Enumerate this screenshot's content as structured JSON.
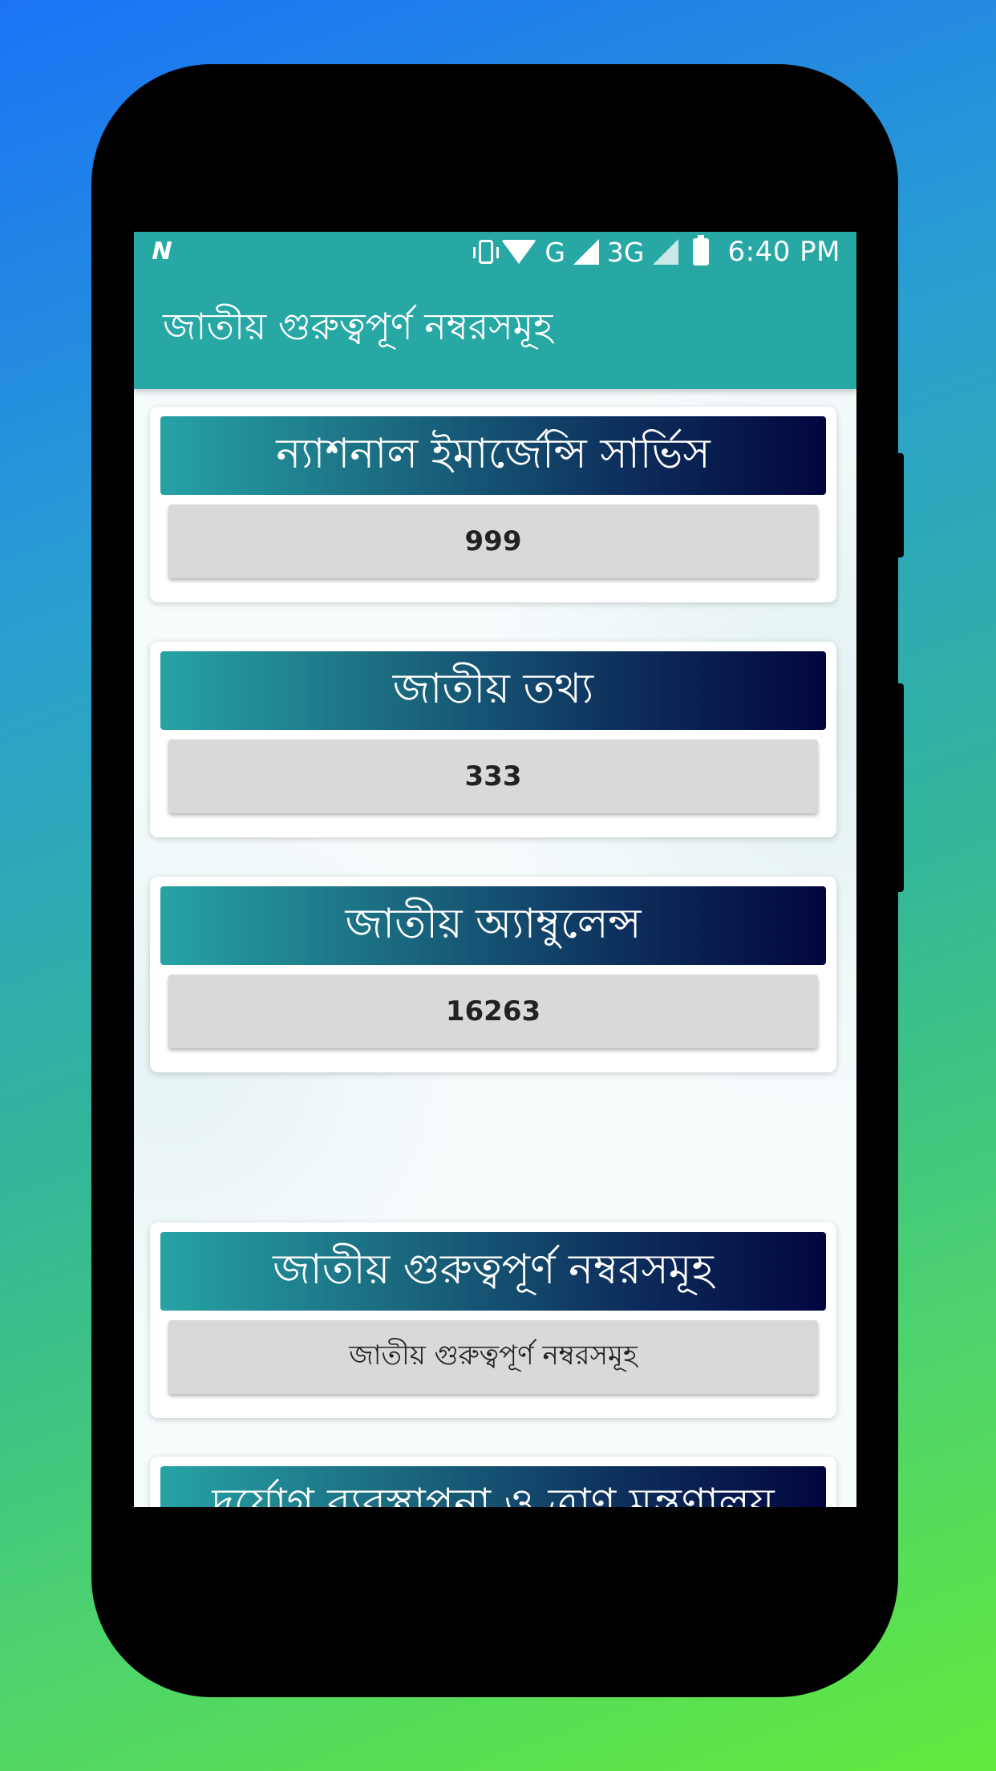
{
  "statusbar": {
    "network_g": "G",
    "network_3g": "3G",
    "time": "6:40 PM"
  },
  "appbar": {
    "title": "জাতীয় গুরুত্বপূর্ণ নম্বরসমূহ"
  },
  "cards": [
    {
      "title": "ন্যাশনাল ইমার্জেন্সি সার্ভিস",
      "number": "999"
    },
    {
      "title": "জাতীয় তথ্য",
      "number": "333"
    },
    {
      "title": "জাতীয় অ্যাম্বুলেন্স",
      "number": "16263"
    },
    {
      "title": "জাতীয় গুরুত্বপূর্ণ নম্বরসমূহ",
      "number": "জাতীয় গুরুত্বপূর্ণ নম্বরসমূহ"
    },
    {
      "title": "দুর্যোগ ব্যবস্থাপনা ও ত্রাণ মন্ত্রণালয়"
    }
  ],
  "icons": {
    "notification": "n-notification-icon",
    "vibrate": "vibrate-icon",
    "wifi": "wifi-icon",
    "signal": "signal-icon",
    "battery": "battery-charging-icon"
  },
  "colors": {
    "appbar": "#27a8a5",
    "header_gradient_start": "#26a3a5",
    "header_gradient_end": "#02063e",
    "number_button_bg": "#d9d9d9"
  }
}
